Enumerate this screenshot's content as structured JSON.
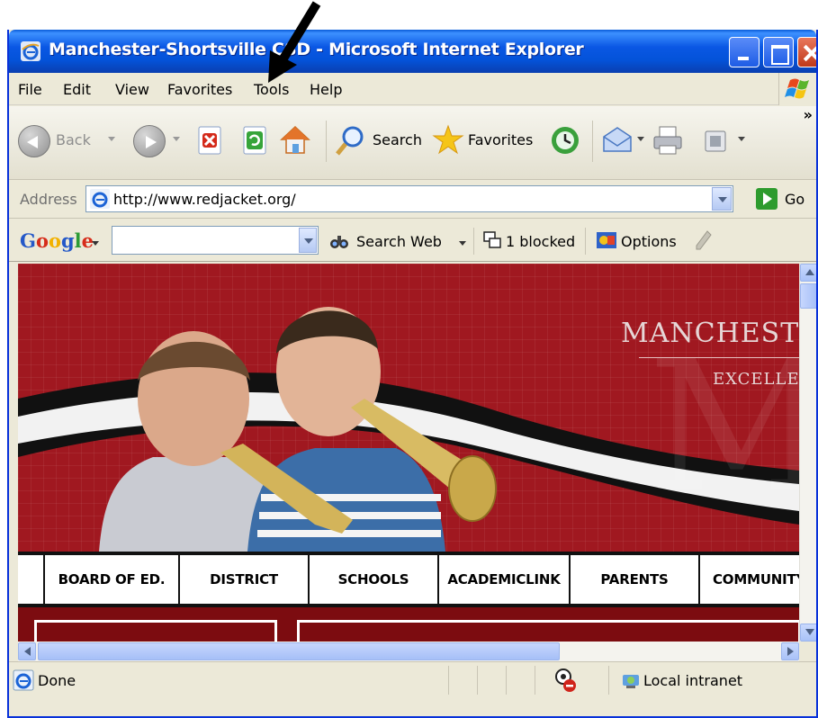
{
  "window": {
    "title": "Manchester-Shortsville CSD - Microsoft Internet Explorer"
  },
  "menu": {
    "items": [
      "File",
      "Edit",
      "View",
      "Favorites",
      "Tools",
      "Help"
    ]
  },
  "toolbar": {
    "back_label": "Back",
    "search_label": "Search",
    "favorites_label": "Favorites",
    "overflow": "»"
  },
  "address": {
    "label": "Address",
    "url": "http://www.redjacket.org/",
    "go_label": "Go"
  },
  "google_toolbar": {
    "logo": "Google",
    "search_web_label": "Search Web",
    "blocked_label": "1 blocked",
    "options_label": "Options"
  },
  "page": {
    "banner_heading": "MANCHESTEF",
    "banner_tagline": "EXCELLEN",
    "nav_items": [
      "BOARD OF ED.",
      "DISTRICT",
      "SCHOOLS",
      "ACADEMICLINK",
      "PARENTS",
      "COMMUNITY"
    ]
  },
  "status": {
    "text": "Done",
    "zone": "Local intranet"
  },
  "colors": {
    "title_bar": "#0453d9",
    "banner_red": "#a01820",
    "chrome": "#ece9d8"
  }
}
